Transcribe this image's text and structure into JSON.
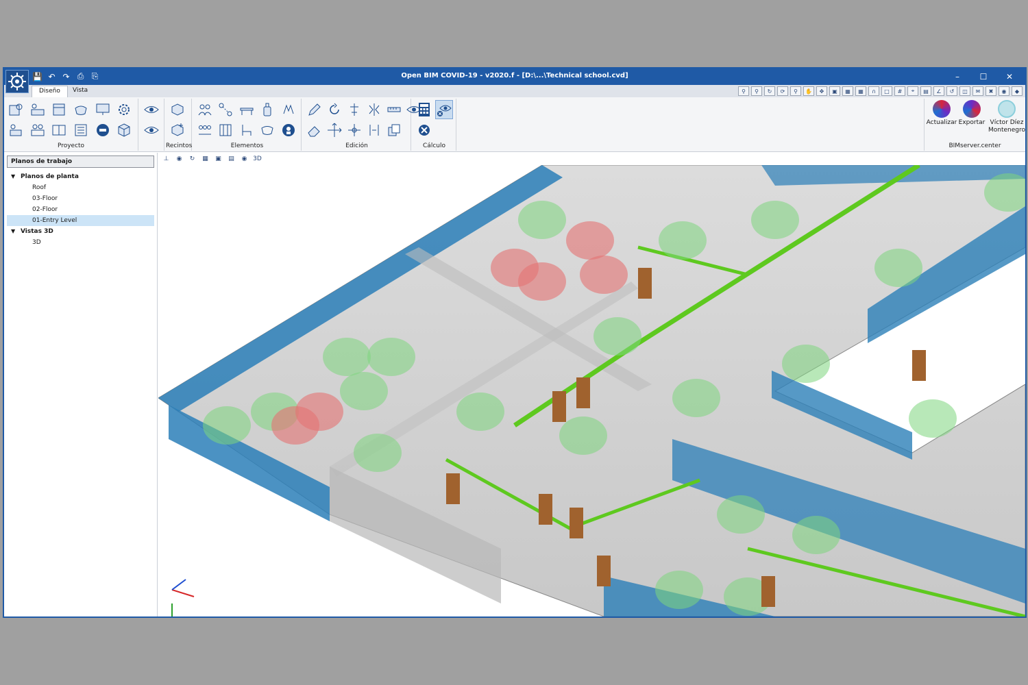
{
  "window": {
    "title": "Open BIM COVID-19 - v2020.f - [D:\\...\\Technical school.cvd]"
  },
  "tabs": [
    "Diseño",
    "Vista"
  ],
  "ribbon": {
    "groups": [
      {
        "label": "Proyecto"
      },
      {
        "label": "Recintos"
      },
      {
        "label": "Elementos"
      },
      {
        "label": "Edición"
      },
      {
        "label": "Cálculo"
      }
    ],
    "bimserver": {
      "label": "BIMserver.center",
      "update_label": "Actualizar",
      "export_label": "Exportar",
      "user_name": "Víctor Díez Montenegro"
    }
  },
  "sidebar": {
    "panel_title": "Planos de trabajo",
    "tree": {
      "floor_plans": {
        "label": "Planos de planta",
        "items": [
          "Roof",
          "03-Floor",
          "02-Floor",
          "01-Entry Level"
        ]
      },
      "views3d": {
        "label": "Vistas 3D",
        "items": [
          "3D"
        ]
      }
    }
  },
  "colors": {
    "accent": "#1f5aa6",
    "safe_zone": "#7ed67e",
    "risk_zone": "#e57373",
    "glass": "#2c7fb8",
    "route": "#5ec91f",
    "door": "#a0622e"
  }
}
